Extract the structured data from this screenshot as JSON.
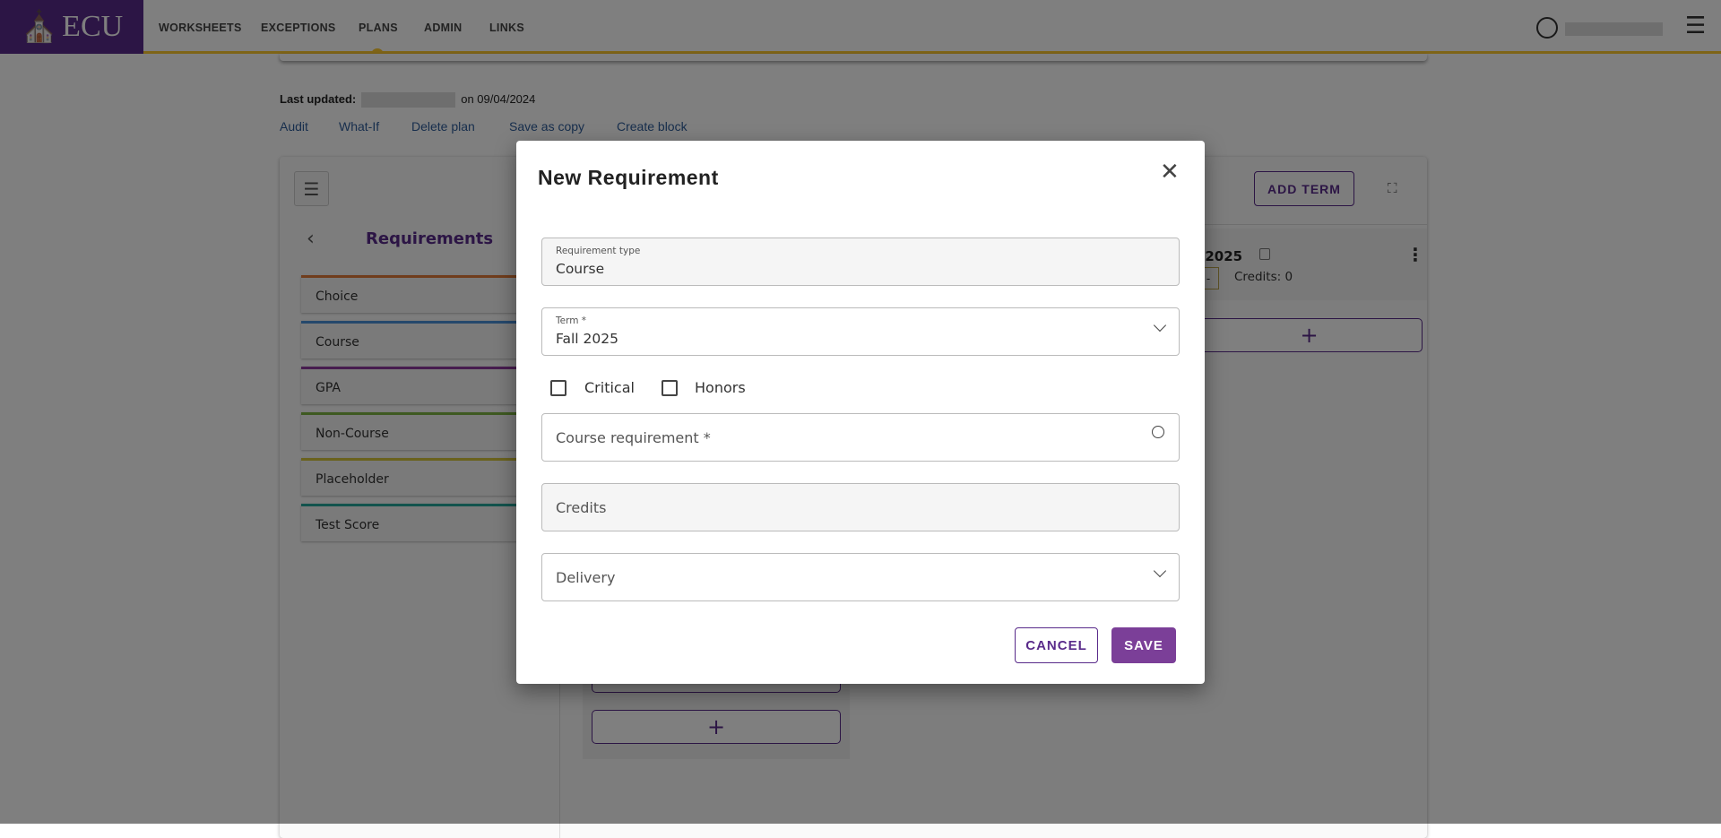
{
  "header": {
    "logo_text": "ECU",
    "nav": [
      "WORKSHEETS",
      "EXCEPTIONS",
      "PLANS",
      "ADMIN",
      "LINKS"
    ],
    "active_nav": "PLANS"
  },
  "plan": {
    "last_updated_label": "Last updated:",
    "last_updated_date": "on 09/04/2024",
    "links": [
      "Audit",
      "What-If",
      "Delete plan",
      "Save as copy",
      "Create block"
    ]
  },
  "sidebar": {
    "title": "Requirements",
    "items": [
      {
        "label": "Choice",
        "color": "#e07b39"
      },
      {
        "label": "Course",
        "color": "#4a90d9"
      },
      {
        "label": "GPA",
        "color": "#8e3a9e"
      },
      {
        "label": "Non-Course",
        "color": "#7cb342"
      },
      {
        "label": "Placeholder",
        "color": "#d4c43a"
      },
      {
        "label": "Test Score",
        "color": "#26a69a"
      }
    ]
  },
  "term": {
    "add_term": "ADD TERM",
    "title_partial": "l 2025",
    "credits": "Credits:  0",
    "plus": "+",
    "minus": "-"
  },
  "modal": {
    "title": "New Requirement",
    "req_type_label": "Requirement type",
    "req_type_value": "Course",
    "term_label": "Term *",
    "term_value": "Fall 2025",
    "critical": "Critical",
    "honors": "Honors",
    "course_req_placeholder": "Course requirement *",
    "credits_placeholder": "Credits",
    "delivery_placeholder": "Delivery",
    "cancel": "CANCEL",
    "save": "SAVE"
  },
  "colors": {
    "brand_purple": "#592a8a",
    "gold": "#fdc82f",
    "save": "#7b3f98"
  }
}
